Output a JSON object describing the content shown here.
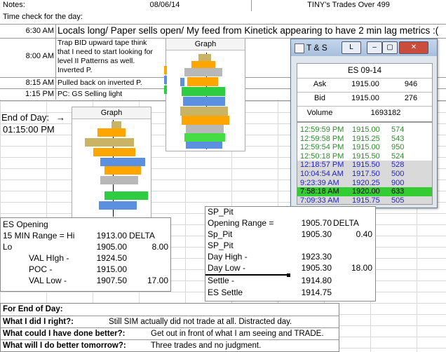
{
  "header": {
    "notes_label": "Notes:",
    "date": "08/06/14",
    "title": "TINY's Trades Over 499",
    "title_underlined": "TINY's"
  },
  "time_check_label": "Time check for the day:",
  "time_entries": [
    {
      "time": "6:30 AM",
      "note": "Locals long/ Paper sells open/ My feed from Kinetick appearing to have 2 min lag metrics :("
    },
    {
      "time": "8:00 AM",
      "note_lines": [
        "Trap BID upward tape think",
        "that I need to start looking for",
        "level II Patterns as well.",
        "Inverted P."
      ]
    },
    {
      "time": "8:15 AM",
      "note": "Pulled back on inverted P."
    },
    {
      "time": "1:15 PM",
      "note": "PC: GS Selling light"
    }
  ],
  "end_of_day": {
    "label": "End of Day:",
    "arrow": "→",
    "time": "01:15:00 PM"
  },
  "graphs": [
    {
      "title": "Graph",
      "id": "graph-top"
    },
    {
      "title": "Graph",
      "id": "graph-bottom"
    }
  ],
  "time_and_sales": {
    "title": "T & S",
    "l_button": "L",
    "symbol": "ES 09-14",
    "ask_label": "Ask",
    "ask_price": "1915.00",
    "ask_size": "946",
    "bid_label": "Bid",
    "bid_price": "1915.00",
    "bid_size": "276",
    "volume_label": "Volume",
    "volume": "1693182",
    "prints": [
      {
        "time": "12:59:59 PM",
        "price": "1915.00",
        "size": "574",
        "color": "#2e8b2e",
        "bg": "#ffffff"
      },
      {
        "time": "12:59:58 PM",
        "price": "1915.25",
        "size": "543",
        "color": "#2e8b2e",
        "bg": "#ffffff"
      },
      {
        "time": "12:59:54 PM",
        "price": "1915.00",
        "size": "950",
        "color": "#2e8b2e",
        "bg": "#ffffff"
      },
      {
        "time": "12:50:18 PM",
        "price": "1915.50",
        "size": "524",
        "color": "#2e8b2e",
        "bg": "#ffffff"
      },
      {
        "time": "12:18:57 PM",
        "price": "1915.50",
        "size": "528",
        "color": "#2222cc",
        "bg": "#d9d9d9"
      },
      {
        "time": "10:04:54 AM",
        "price": "1917.50",
        "size": "500",
        "color": "#2222cc",
        "bg": "#d9d9d9"
      },
      {
        "time": "9:23:39 AM",
        "price": "1920.25",
        "size": "900",
        "color": "#2222cc",
        "bg": "#d9d9d9"
      },
      {
        "time": "7:58:18 AM",
        "price": "1920.00",
        "size": "633",
        "color": "#000000",
        "bg": "#33cc33"
      },
      {
        "time": "7:09:33 AM",
        "price": "1915.75",
        "size": "505",
        "color": "#2222cc",
        "bg": "#d9d9d9"
      }
    ]
  },
  "es_opening": {
    "title": "ES Opening",
    "rows": [
      {
        "label": "15 MIN Range = Hi",
        "value": "1913.00",
        "extra": "DELTA"
      },
      {
        "label": "Lo",
        "value": "1905.00",
        "extra": "8.00"
      },
      {
        "label": "VAL HIgh  -",
        "value": "1924.50",
        "extra": ""
      },
      {
        "label": "POC   -",
        "value": "1915.00",
        "extra": ""
      },
      {
        "label": "VAL Low   -",
        "value": "1907.50",
        "extra": "17.00"
      }
    ]
  },
  "sp_pit": {
    "rows": [
      {
        "label": "SP_Pit",
        "value": "",
        "extra": ""
      },
      {
        "label": "Opening Range =",
        "value": "1905.70",
        "extra": "DELTA"
      },
      {
        "label": "Sp_Pit",
        "value": "1905.30",
        "extra": "0.40"
      },
      {
        "label": "SP_Pit",
        "value": "",
        "extra": ""
      },
      {
        "label": "Day High -",
        "value": "1923.30",
        "extra": ""
      },
      {
        "label": "Day Low -",
        "value": "1905.30",
        "extra": "18.00"
      },
      {
        "label": "Settle -",
        "value": "1914.80",
        "extra": ""
      },
      {
        "label": "ES Settle",
        "value": "1914.75",
        "extra": ""
      }
    ]
  },
  "review": {
    "heading": "For End of Day:",
    "q1": "What I did I right?:",
    "a1": "Still SIM actually did not trade at all.  Distracted day.",
    "q2": "What could I have done better?:",
    "a2": "Get out in front of what I am seeing and TRADE.",
    "q3": "What will I do better tomorrow?:",
    "a3": "Three trades and no judgment."
  },
  "colors": {
    "bar_orange": "#ffa500",
    "bar_olive": "#c8b464",
    "bar_green": "#2ecc40",
    "bar_blue": "#5b8fe0",
    "bar_gray": "#b8b8b8",
    "bar_lightgreen": "#44dd44"
  }
}
